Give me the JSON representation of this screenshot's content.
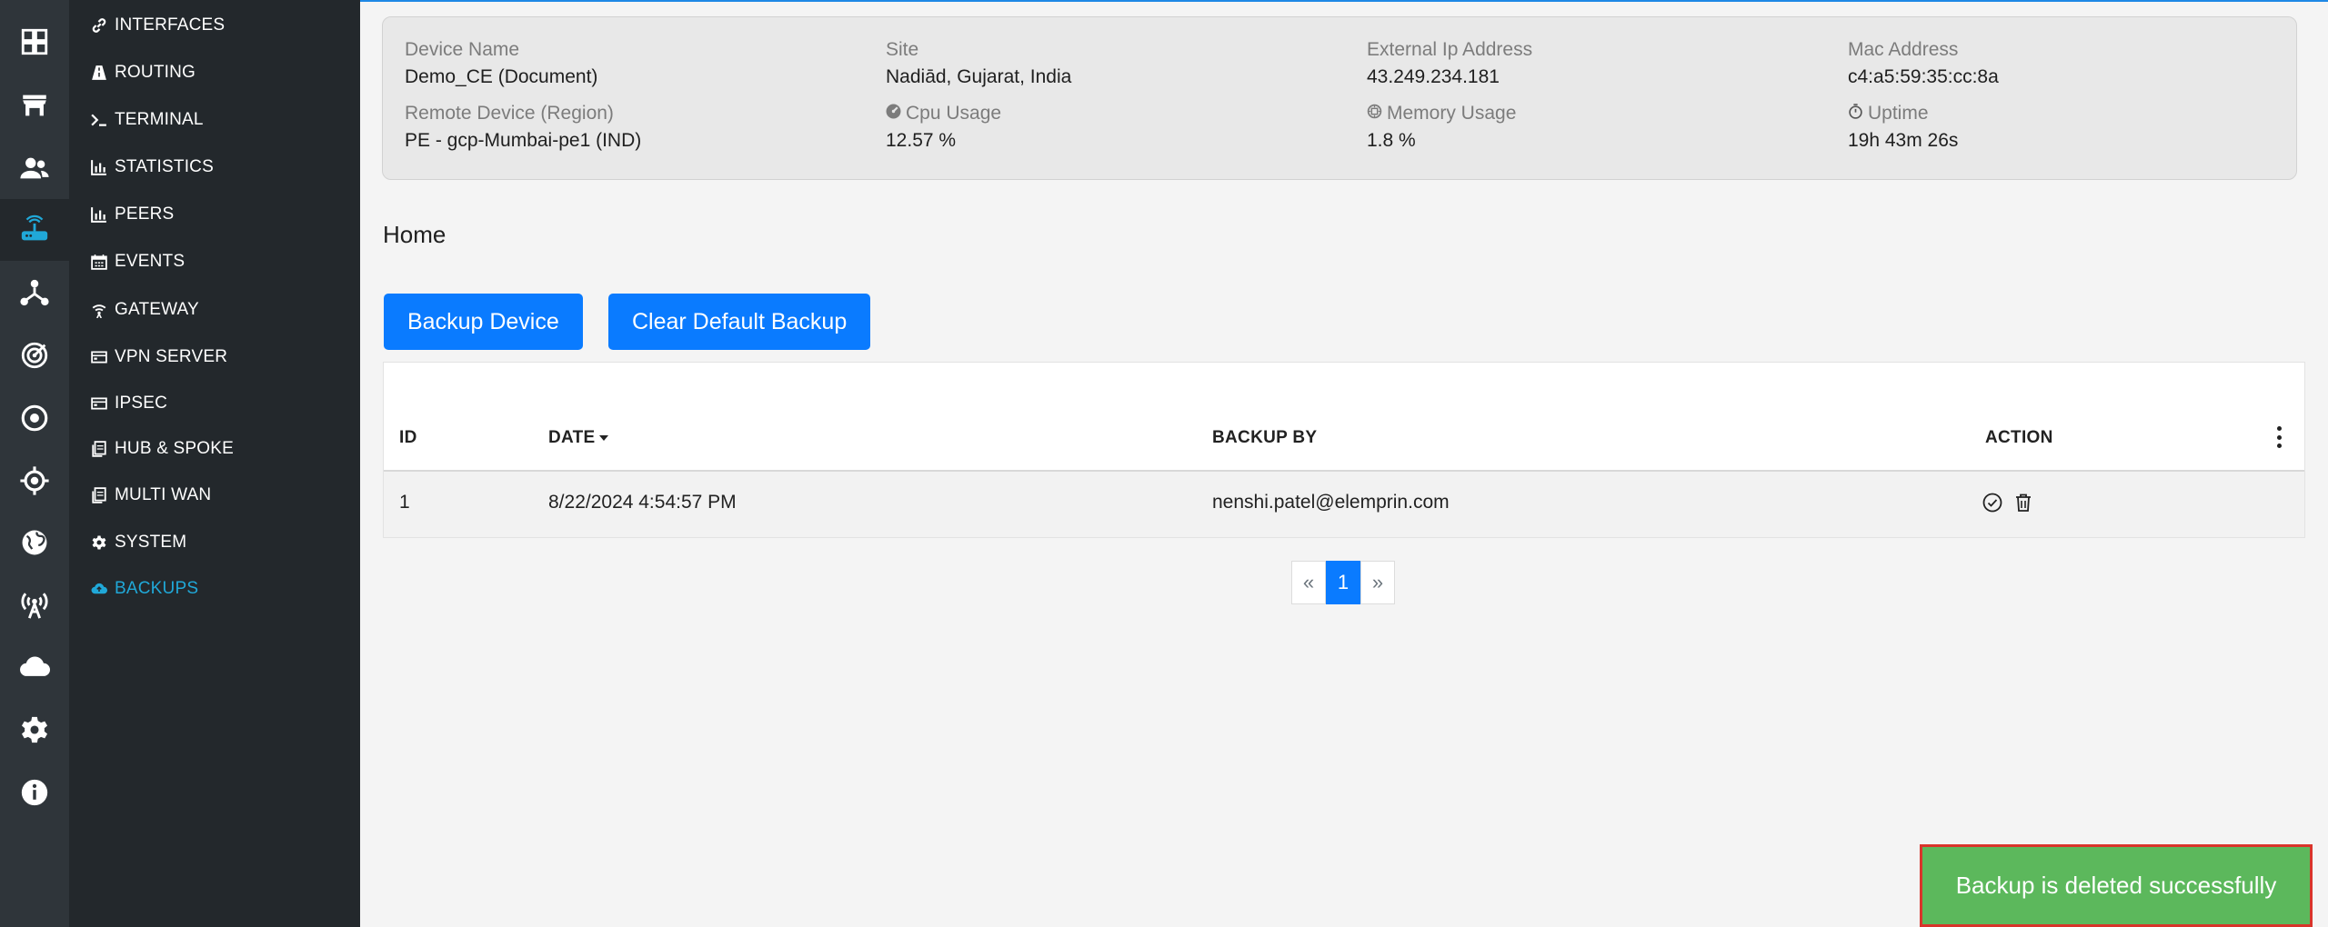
{
  "colors": {
    "accent": "#0a7bff",
    "sidebar_active": "#20a8d8",
    "toast_bg": "#5cb85c",
    "toast_border": "#d9342b"
  },
  "rail": {
    "items": [
      {
        "icon": "dashboard-icon"
      },
      {
        "icon": "store-icon"
      },
      {
        "icon": "users-icon"
      },
      {
        "icon": "router-icon",
        "active": true
      },
      {
        "icon": "network-icon"
      },
      {
        "icon": "radar-icon"
      },
      {
        "icon": "target-icon"
      },
      {
        "icon": "crosshair-icon"
      },
      {
        "icon": "globe-icon"
      },
      {
        "icon": "antenna-icon"
      },
      {
        "icon": "cloud-icon"
      },
      {
        "icon": "gear-icon"
      },
      {
        "icon": "info-icon"
      }
    ]
  },
  "subnav": {
    "items": [
      {
        "label": "INTERFACES",
        "icon": "link-icon"
      },
      {
        "label": "ROUTING",
        "icon": "road-icon"
      },
      {
        "label": "TERMINAL",
        "icon": "terminal-icon"
      },
      {
        "label": "STATISTICS",
        "icon": "bar-chart-icon"
      },
      {
        "label": "PEERS",
        "icon": "bar-chart-icon"
      },
      {
        "label": "EVENTS",
        "icon": "calendar-icon"
      },
      {
        "label": "GATEWAY",
        "icon": "wifi-icon"
      },
      {
        "label": "VPN SERVER",
        "icon": "server-icon"
      },
      {
        "label": "IPSEC",
        "icon": "server-icon"
      },
      {
        "label": "HUB & SPOKE",
        "icon": "copy-icon"
      },
      {
        "label": "MULTI WAN",
        "icon": "copy-icon"
      },
      {
        "label": "SYSTEM",
        "icon": "cog-icon"
      },
      {
        "label": "BACKUPS",
        "icon": "cloud-upload-icon",
        "active": true
      }
    ]
  },
  "device": {
    "name_label": "Device Name",
    "name": "Demo_CE (Document)",
    "site_label": "Site",
    "site": "Nadiād, Gujarat, India",
    "ext_ip_label": "External Ip Address",
    "ext_ip": "43.249.234.181",
    "mac_label": "Mac Address",
    "mac": "c4:a5:59:35:cc:8a",
    "remote_label": "Remote Device (Region)",
    "remote": "PE - gcp-Mumbai-pe1 (IND)",
    "cpu_label": "Cpu Usage",
    "cpu": "12.57 %",
    "memory_label": "Memory Usage",
    "memory": "1.8 %",
    "uptime_label": "Uptime",
    "uptime": "19h 43m 26s"
  },
  "page": {
    "title": "Home"
  },
  "buttons": {
    "backup": "Backup Device",
    "clear": "Clear Default Backup"
  },
  "table": {
    "columns": {
      "id": "ID",
      "date": "DATE",
      "backup_by": "BACKUP BY",
      "action": "ACTION"
    },
    "rows": [
      {
        "id": "1",
        "date": "8/22/2024 4:54:57 PM",
        "backup_by": "nenshi.patel@elemprin.com"
      }
    ]
  },
  "pagination": {
    "prev": "«",
    "current": "1",
    "next": "»"
  },
  "toast": {
    "message": "Backup is deleted successfully"
  }
}
